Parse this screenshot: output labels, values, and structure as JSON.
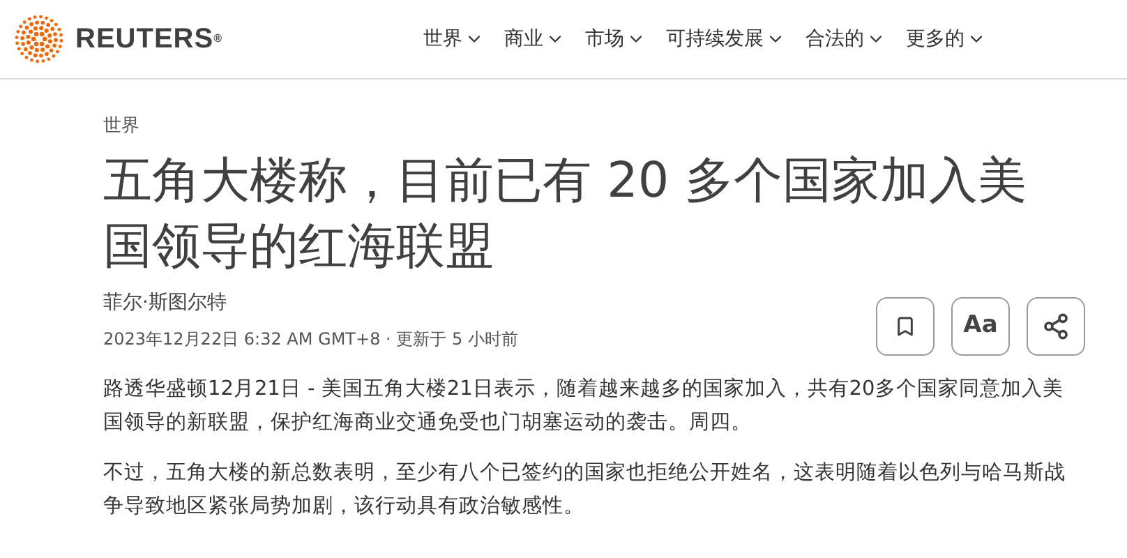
{
  "header": {
    "brand": "REUTERS",
    "brand_mark": "®",
    "nav": [
      "世界",
      "商业",
      "市场",
      "可持续发展",
      "合法的",
      "更多的"
    ]
  },
  "article": {
    "section": "世界",
    "headline": "五角大楼称，目前已有 20 多个国家加入美国领导的红海联盟",
    "author": "菲尔·斯图尔特",
    "dateline": "2023年12月22日 6:32 AM GMT+8 · 更新于 5 小时前",
    "text_size_button": "Aa",
    "paragraphs": [
      "路透华盛顿12月21日 - 美国五角大楼21日表示，随着越来越多的国家加入，共有20多个国家同意加入美国领导的新联盟，保护红海商业交通免受也门胡塞运动的袭击。周四。",
      "不过，五角大楼的新总数表明，至少有八个已签约的国家也拒绝公开姓名，这表明随着以色列与哈马斯战争导致地区紧张局势加剧，该行动具有政治敏感性。"
    ]
  }
}
